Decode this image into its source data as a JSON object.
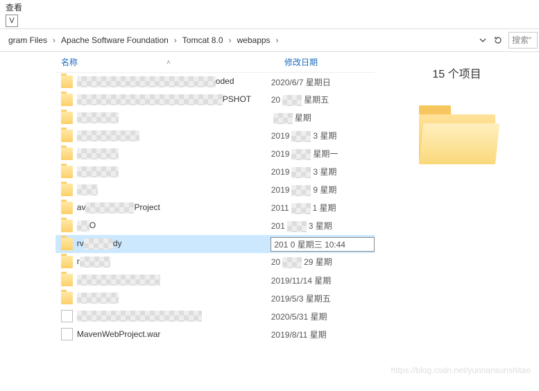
{
  "window": {
    "tab_label": "查看",
    "tab_key": "V"
  },
  "breadcrumb": {
    "items": [
      "gram Files",
      "Apache Software Foundation",
      "Tomcat 8.0",
      "webapps"
    ]
  },
  "search": {
    "placeholder": "搜索\""
  },
  "columns": {
    "name": "名称",
    "date": "修改日期"
  },
  "panel": {
    "count_label": "15 个项目"
  },
  "rows": [
    {
      "type": "folder",
      "name_vis": "oded",
      "name_pre_w": 200,
      "date": "2020/6/7 星期日",
      "date_vis": "2020/6/7 星期日"
    },
    {
      "type": "folder",
      "name_vis": "PSHOT",
      "name_pre_w": 210,
      "date": "20",
      "date_suffix": "星期五",
      "blur_mid": true
    },
    {
      "type": "folder",
      "name_vis": "",
      "name_pre_w": 60,
      "date": "",
      "date_suffix": "星期",
      "blur_mid": true
    },
    {
      "type": "folder",
      "name_vis": "",
      "name_pre_w": 90,
      "date": "2019",
      "date_suffix": "3 星期",
      "blur_mid": true
    },
    {
      "type": "folder",
      "name_vis": "",
      "name_pre_w": 60,
      "date": "2019",
      "date_suffix": "星期一",
      "blur_mid": true
    },
    {
      "type": "folder",
      "name_vis": "",
      "name_pre_w": 60,
      "date": "2019",
      "date_suffix": "3 星期",
      "blur_mid": true
    },
    {
      "type": "folder",
      "name_vis": "",
      "name_pre_w": 30,
      "date": "2019",
      "date_suffix": "9 星期",
      "blur_mid": true
    },
    {
      "type": "folder",
      "name_vis": "Project",
      "name_pre_w": 70,
      "name_vis_pre": "av",
      "date": "2011",
      "date_suffix": "1 星期",
      "blur_mid": true
    },
    {
      "type": "folder",
      "name_vis": "O",
      "name_pre_w": 18,
      "date": "201",
      "date_suffix": "3 星期",
      "blur_mid": true
    },
    {
      "type": "folder",
      "name_vis": "dy",
      "name_pre_w": 42,
      "name_vis_pre": "rv",
      "date": "201        0 星期三 10:44",
      "selected": true
    },
    {
      "type": "folder",
      "name_vis": "",
      "name_pre_w": 44,
      "name_vis_pre": "r",
      "date": "20",
      "date_suffix": "29 星期",
      "blur_mid": true
    },
    {
      "type": "folder",
      "name_vis": "",
      "name_pre_w": 120,
      "date": "2019/11/14 星期"
    },
    {
      "type": "folder",
      "name_vis": "",
      "name_pre_w": 60,
      "date": "2019/5/3 星期五"
    },
    {
      "type": "file",
      "name_vis": "",
      "name_pre_w": 180,
      "date": "2020/5/31 星期"
    },
    {
      "type": "file",
      "name_full": "MavenWebProject.war",
      "date": "2019/8/11 星期"
    }
  ],
  "watermark": "https://blog.csdn.net/yunnansunshitao"
}
